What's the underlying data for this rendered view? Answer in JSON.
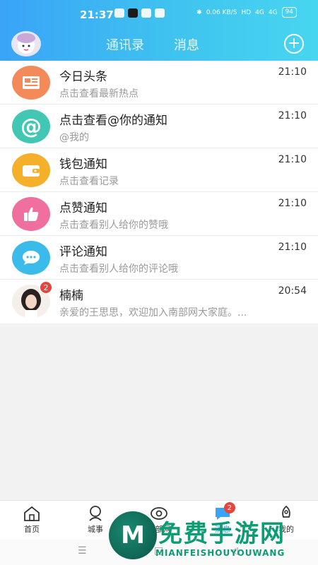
{
  "status_bar": {
    "time": "21:37",
    "network_speed": "0.06 KB/S",
    "hd": "HD",
    "signal_1": "4G",
    "signal_2": "4G",
    "battery": "94"
  },
  "header": {
    "tabs": [
      {
        "label": "通讯录",
        "active": false
      },
      {
        "label": "消息",
        "active": true
      }
    ],
    "add_icon": "plus-circle-icon",
    "accent": "#3aa4f7"
  },
  "messages": [
    {
      "title": "今日头条",
      "subtitle": "点击查看最新热点",
      "time": "21:10",
      "icon": "newspaper-icon",
      "color": "#f28a5a"
    },
    {
      "title": "点击查看@你的通知",
      "subtitle": "@我的",
      "time": "21:10",
      "icon": "at-icon",
      "color": "#42c7b4"
    },
    {
      "title": "钱包通知",
      "subtitle": "点击查看记录",
      "time": "21:10",
      "icon": "wallet-icon",
      "color": "#f5b02b"
    },
    {
      "title": "点赞通知",
      "subtitle": "点击查看别人给你的赞哦",
      "time": "21:10",
      "icon": "thumbs-up-icon",
      "color": "#ef6f9f"
    },
    {
      "title": "评论通知",
      "subtitle": "点击查看别人给你的评论哦",
      "time": "21:10",
      "icon": "comment-icon",
      "color": "#3bbbe9"
    },
    {
      "title": "楠楠",
      "subtitle": "亲爱的王思思，欢迎加入南部网大家庭。...",
      "time": "20:54",
      "icon": "avatar",
      "badge": "2"
    }
  ],
  "bottom_nav": [
    {
      "label": "首页",
      "icon": "home-icon"
    },
    {
      "label": "城事",
      "icon": "city-icon"
    },
    {
      "label": "南部网",
      "icon": "eye-icon"
    },
    {
      "label": "消息",
      "icon": "message-icon",
      "badge": "2"
    },
    {
      "label": "我的",
      "icon": "rocket-icon"
    }
  ],
  "watermark": {
    "title": "免费手游网",
    "subtitle": "MIANFEISHOUYOUWANG",
    "logo_letter": "M"
  }
}
